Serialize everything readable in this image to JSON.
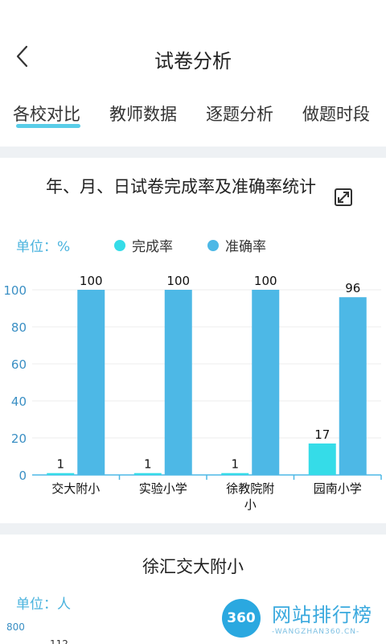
{
  "header": {
    "title": "试卷分析"
  },
  "tabs": [
    {
      "label": "各校对比",
      "active": true
    },
    {
      "label": "教师数据",
      "active": false
    },
    {
      "label": "逐题分析",
      "active": false
    },
    {
      "label": "做题时段",
      "active": false
    }
  ],
  "card1": {
    "title": "年、月、日试卷完成率及准确率统计",
    "unit_label": "单位：%",
    "expand_icon": "expand-icon"
  },
  "chart_data": {
    "type": "bar",
    "categories": [
      "交大附小",
      "实验小学",
      "徐教院附小",
      "园南小学"
    ],
    "series": [
      {
        "name": "完成率",
        "values": [
          1,
          1,
          1,
          17
        ],
        "color": "#35dce8"
      },
      {
        "name": "准确率",
        "values": [
          100,
          100,
          100,
          96
        ],
        "color": "#4db8e6"
      }
    ],
    "ylim": [
      0,
      100
    ],
    "yticks": [
      0,
      20,
      40,
      60,
      80,
      100
    ],
    "legend": "top",
    "grid": true
  },
  "card2": {
    "title": "徐汇交大附小",
    "unit_label": "单位：人",
    "ytick_top": "800",
    "peek_value": "112"
  },
  "watermark": {
    "logo_text": "360",
    "title": "网站排行榜",
    "subtitle": "-WANGZHAN360.CN-"
  },
  "colors": {
    "accent": "#3cc4e4",
    "unit": "#4ab3de"
  }
}
